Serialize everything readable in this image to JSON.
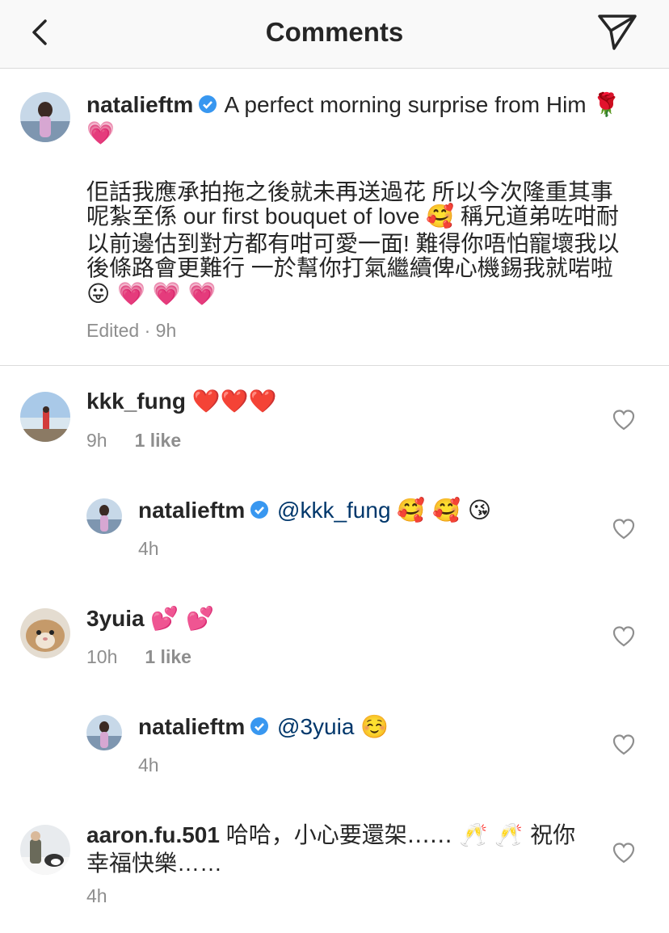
{
  "header": {
    "title": "Comments"
  },
  "caption": {
    "username": "nataliеftm",
    "line1": "A perfect morning surprise from Him 🌹",
    "line1b": "💗",
    "body_lines": [
      "佢話我應承拍拖之後就未再送過花 所以今次隆重其事",
      "呢紮至係 our first bouquet of love 🥰 稱兄道弟咗咁耐",
      "以前邊估到對方都有咁可愛一面! 難得你唔怕寵壞我以",
      "後條路會更難行 一於幫你打氣繼續俾心機錫我就啱啦",
      "😛 💗 💗 💗"
    ],
    "meta": "Edited · 9h"
  },
  "comments": [
    {
      "username": "kkk_fung",
      "text": "❤️❤️❤️",
      "time": "9h",
      "likes": "1 like"
    },
    {
      "username": "nataliеftm",
      "mention": "@kkk_fung",
      "text": "🥰 🥰 😘",
      "time": "4h"
    },
    {
      "username": "3yuia",
      "text": "💕 💕",
      "time": "10h",
      "likes": "1 like"
    },
    {
      "username": "nataliеftm",
      "mention": "@3yuia",
      "text": "☺️",
      "time": "4h"
    },
    {
      "username": "aaron.fu.501",
      "text": "哈哈，小心要還架…… 🥂 🥂 祝你",
      "text2": "幸福快樂……",
      "time": "4h"
    }
  ]
}
